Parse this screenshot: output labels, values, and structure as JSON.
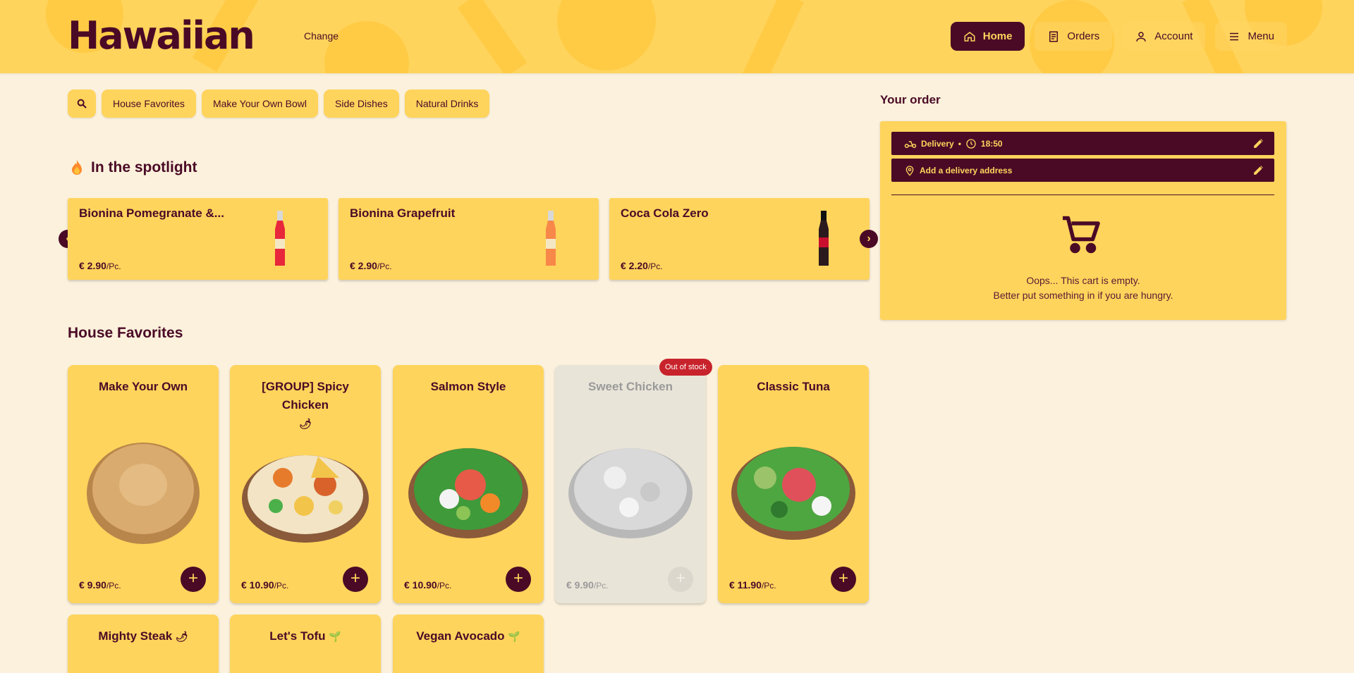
{
  "header": {
    "brand": "Hawaiian",
    "change_label": "Change",
    "nav": [
      {
        "label": "Home",
        "icon": "home-icon",
        "active": true
      },
      {
        "label": "Orders",
        "icon": "receipt-icon"
      },
      {
        "label": "Account",
        "icon": "user-icon"
      },
      {
        "label": "Menu",
        "icon": "hamburger-icon"
      }
    ]
  },
  "categories": [
    "House Favorites",
    "Make Your Own Bowl",
    "Side Dishes",
    "Natural Drinks"
  ],
  "spotlight": {
    "title": "In the spotlight",
    "items": [
      {
        "name": "Bionina Pomegranate &...",
        "price": "€ 2.90",
        "unit": "/Pc.",
        "color": "#e8273a"
      },
      {
        "name": "Bionina Grapefruit",
        "price": "€ 2.90",
        "unit": "/Pc.",
        "color": "#f8874a"
      },
      {
        "name": "Coca Cola Zero",
        "price": "€ 2.20",
        "unit": "/Pc.",
        "color": "#2a1a1e"
      }
    ]
  },
  "house_favorites": {
    "title": "House Favorites",
    "products": [
      {
        "name": "Make Your Own",
        "price": "€ 9.90",
        "unit": "/Pc."
      },
      {
        "name": "[GROUP] Spicy Chicken",
        "price": "€ 10.90",
        "unit": "/Pc."
      },
      {
        "name": "Salmon Style",
        "price": "€ 10.90",
        "unit": "/Pc."
      },
      {
        "name": "Sweet Chicken",
        "price": "€ 9.90",
        "unit": "/Pc."
      },
      {
        "name": "Classic Tuna",
        "price": "€ 11.90",
        "unit": "/Pc."
      },
      {
        "name": "Mighty Steak"
      },
      {
        "name": "Let's Tofu"
      },
      {
        "name": "Vegan Avocado"
      }
    ],
    "out_of_stock_label": "Out of stock"
  },
  "order": {
    "title": "Your order",
    "delivery_label": "Delivery",
    "time": "18:50",
    "address_label": "Add a delivery address",
    "empty_line1": "Oops... This cart is empty.",
    "empty_line2": "Better put something in if you are hungry."
  },
  "colors": {
    "accent": "#ffd45c",
    "brand": "#4a0a26",
    "background": "#fbf1dc",
    "badge": "#c8232c"
  }
}
